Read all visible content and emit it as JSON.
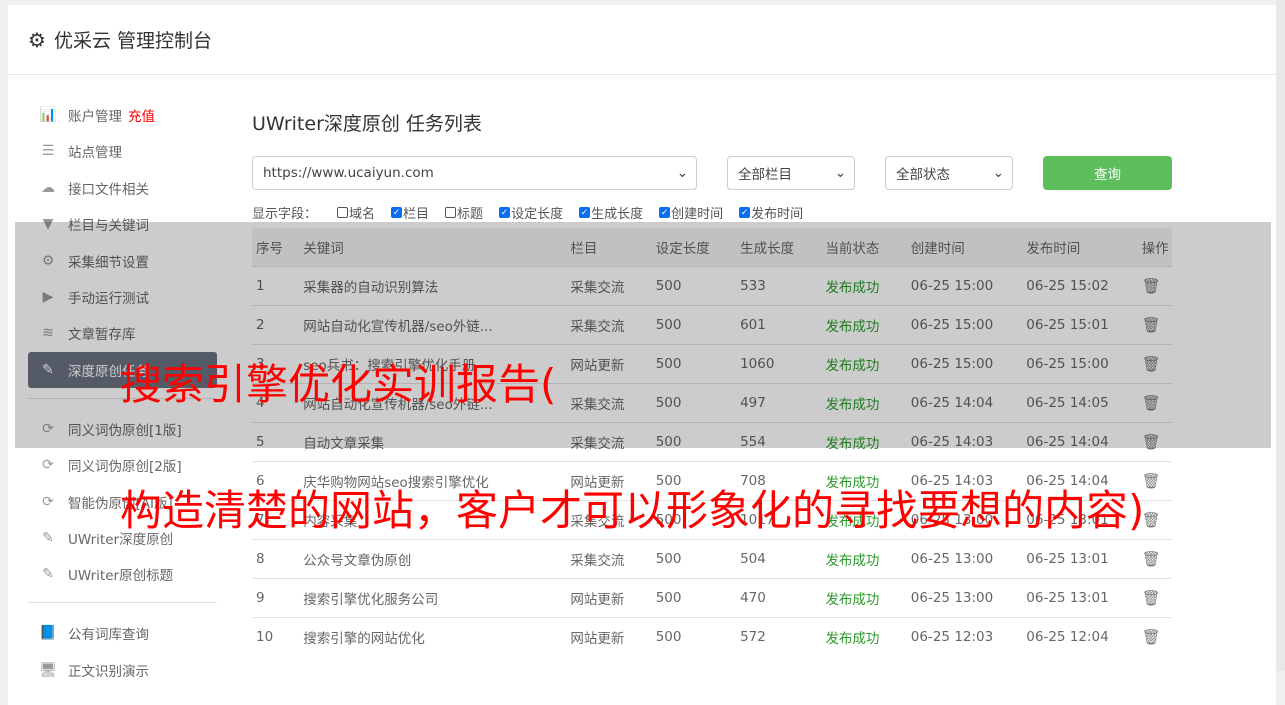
{
  "header": {
    "title": "优采云 管理控制台",
    "icon": "gear-icon"
  },
  "sidebar": {
    "items": [
      {
        "label": "账户管理",
        "extra": "充值",
        "icon": "bar-chart-icon",
        "glyph": "📊"
      },
      {
        "label": "站点管理",
        "icon": "server-icon",
        "glyph": "☰"
      },
      {
        "label": "接口文件相关",
        "icon": "cloud-upload-icon",
        "glyph": "☁"
      },
      {
        "label": "栏目与关键词",
        "icon": "filter-icon",
        "glyph": "▼"
      },
      {
        "label": "采集细节设置",
        "icon": "gears-icon",
        "glyph": "⚙"
      },
      {
        "label": "手动运行测试",
        "icon": "play-icon",
        "glyph": "▶"
      },
      {
        "label": "文章暂存库",
        "icon": "database-icon",
        "glyph": "≋"
      },
      {
        "label": "深度原创任务",
        "icon": "edit-icon",
        "glyph": "✎"
      }
    ],
    "items2": [
      {
        "label": "同义词伪原创[1版]",
        "icon": "refresh-icon",
        "glyph": "⟳"
      },
      {
        "label": "同义词伪原创[2版]",
        "icon": "refresh-icon",
        "glyph": "⟳"
      },
      {
        "label": "智能伪原创[AI版]",
        "icon": "refresh-icon",
        "glyph": "⟳"
      },
      {
        "label": "UWriter深度原创",
        "icon": "edit-icon",
        "glyph": "✎"
      },
      {
        "label": "UWriter原创标题",
        "icon": "edit-icon",
        "glyph": "✎"
      }
    ],
    "items3": [
      {
        "label": "公有词库查询",
        "icon": "book-icon",
        "glyph": "📘"
      },
      {
        "label": "正文识别演示",
        "icon": "monitor-icon",
        "glyph": "🖥"
      }
    ]
  },
  "main": {
    "title": "UWriter深度原创 任务列表",
    "site_select": "https://www.ucaiyun.com",
    "column_select": "全部栏目",
    "status_select": "全部状态",
    "query_label": "查询",
    "fields_label": "显示字段：",
    "fields": [
      {
        "label": "域名",
        "checked": false
      },
      {
        "label": "栏目",
        "checked": true
      },
      {
        "label": "标题",
        "checked": false
      },
      {
        "label": "设定长度",
        "checked": true
      },
      {
        "label": "生成长度",
        "checked": true
      },
      {
        "label": "创建时间",
        "checked": true
      },
      {
        "label": "发布时间",
        "checked": true
      }
    ],
    "columns": [
      "序号",
      "关键词",
      "栏目",
      "设定长度",
      "生成长度",
      "当前状态",
      "创建时间",
      "发布时间",
      "操作"
    ],
    "rows": [
      [
        "1",
        "采集器的自动识别算法",
        "采集交流",
        "500",
        "533",
        "发布成功",
        "06-25 15:00",
        "06-25 15:02"
      ],
      [
        "2",
        "网站自动化宣传机器/seo外链...",
        "采集交流",
        "500",
        "601",
        "发布成功",
        "06-25 15:00",
        "06-25 15:01"
      ],
      [
        "3",
        "seo兵书：搜索引擎优化手册",
        "网站更新",
        "500",
        "1060",
        "发布成功",
        "06-25 15:00",
        "06-25 15:00"
      ],
      [
        "4",
        "网站自动化宣传机器/seo外链...",
        "采集交流",
        "500",
        "497",
        "发布成功",
        "06-25 14:04",
        "06-25 14:05"
      ],
      [
        "5",
        "自动文章采集",
        "采集交流",
        "500",
        "554",
        "发布成功",
        "06-25 14:03",
        "06-25 14:04"
      ],
      [
        "6",
        "庆华购物网站seo搜索引擎优化",
        "网站更新",
        "500",
        "708",
        "发布成功",
        "06-25 14:03",
        "06-25 14:04"
      ],
      [
        "7",
        "内容采集",
        "采集交流",
        "500",
        "1017",
        "发布成功",
        "06-25 13:00",
        "06-25 13:01"
      ],
      [
        "8",
        "公众号文章伪原创",
        "采集交流",
        "500",
        "504",
        "发布成功",
        "06-25 13:00",
        "06-25 13:01"
      ],
      [
        "9",
        "搜索引擎优化服务公司",
        "网站更新",
        "500",
        "470",
        "发布成功",
        "06-25 13:00",
        "06-25 13:01"
      ],
      [
        "10",
        "搜索引擎的网站优化",
        "网站更新",
        "500",
        "572",
        "发布成功",
        "06-25 12:03",
        "06-25 12:04"
      ]
    ]
  },
  "overlay": {
    "line1": "搜索引擎优化实训报告(",
    "line2": "构造清楚的网站，客户才可以形象化的寻找要想的内容)"
  }
}
